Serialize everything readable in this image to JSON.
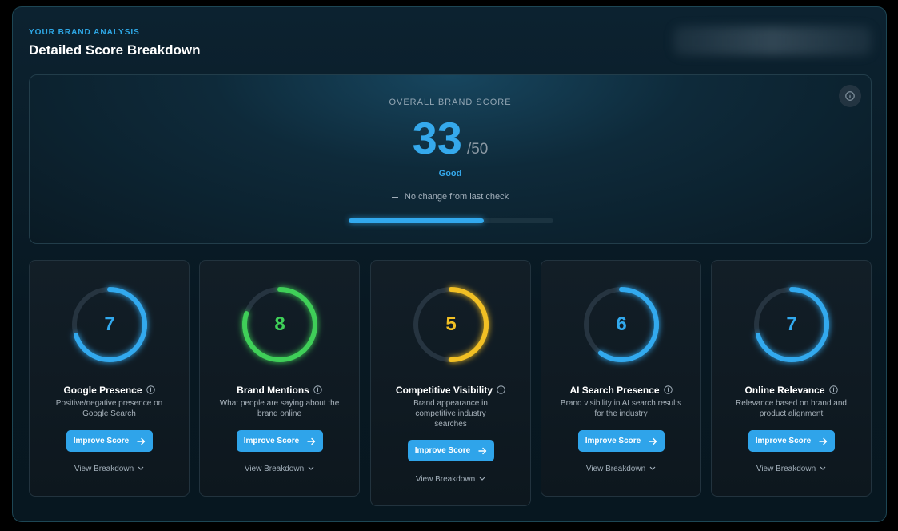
{
  "header": {
    "eyebrow": "YOUR BRAND ANALYSIS",
    "title": "Detailed Score Breakdown"
  },
  "overall": {
    "label": "OVERALL BRAND SCORE",
    "score": "33",
    "max": "/50",
    "rating": "Good",
    "change": "No change from last check",
    "progress_fraction": 0.66,
    "info_icon": "info-icon"
  },
  "colors": {
    "accent_blue": "#32a9ee",
    "green": "#3fcf58",
    "yellow": "#f1bf24"
  },
  "cards": [
    {
      "value": "7",
      "fraction": 0.7,
      "color": "#32a9ee",
      "title": "Google Presence",
      "description": "Positive/negative presence on Google Search",
      "button": "Improve Score",
      "breakdown": "View Breakdown"
    },
    {
      "value": "8",
      "fraction": 0.8,
      "color": "#3fcf58",
      "title": "Brand Mentions",
      "description": "What people are saying about the brand online",
      "button": "Improve Score",
      "breakdown": "View Breakdown"
    },
    {
      "value": "5",
      "fraction": 0.5,
      "color": "#f1bf24",
      "title": "Competitive Visibility",
      "description": "Brand appearance in competitive industry searches",
      "button": "Improve Score",
      "breakdown": "View Breakdown"
    },
    {
      "value": "6",
      "fraction": 0.6,
      "color": "#32a9ee",
      "title": "AI Search Presence",
      "description": "Brand visibility in AI search results for the industry",
      "button": "Improve Score",
      "breakdown": "View Breakdown"
    },
    {
      "value": "7",
      "fraction": 0.7,
      "color": "#32a9ee",
      "title": "Online Relevance",
      "description": "Relevance based on brand and product alignment",
      "button": "Improve Score",
      "breakdown": "View Breakdown"
    }
  ]
}
